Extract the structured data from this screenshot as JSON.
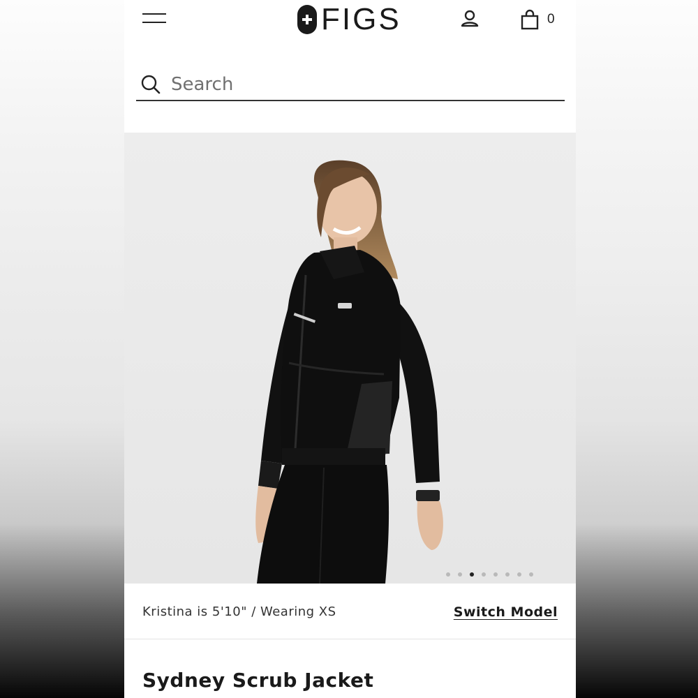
{
  "header": {
    "logo_text": "FIGS",
    "cart_count": "0",
    "menu_icon": "hamburger-icon",
    "account_icon": "user-icon",
    "cart_icon": "shopping-bag-icon"
  },
  "search": {
    "placeholder": "Search",
    "value": ""
  },
  "gallery": {
    "image_count": 8,
    "active_index": 2
  },
  "model_info": {
    "text": "Kristina is 5'10\" / Wearing XS",
    "switch_label": "Switch Model"
  },
  "product": {
    "title": "Sydney Scrub Jacket"
  },
  "colors": {
    "text": "#1a1a1a",
    "hero_background": "#eaeaea",
    "garment": "#111111"
  }
}
